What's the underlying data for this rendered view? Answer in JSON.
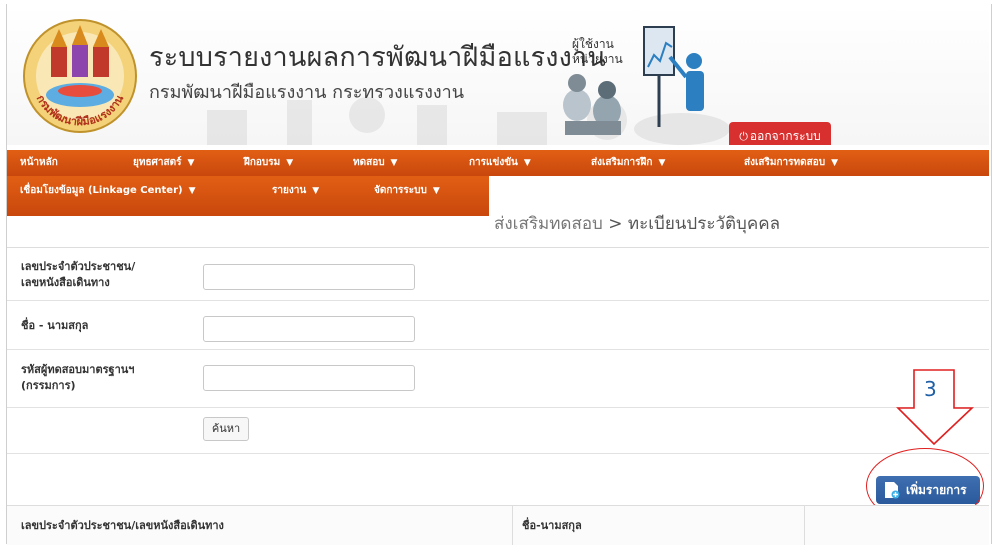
{
  "header": {
    "title": "ระบบรายงานผลการพัฒนาฝีมือแรงงาน",
    "subtitle": "กรมพัฒนาฝีมือแรงงาน กระทรวงแรงงาน",
    "role_line1": "ผู้ใช้งาน",
    "role_line2": "หน่วยงาน",
    "logo_text": "กรมพัฒนาฝีมือแรงงาน",
    "logout_label": "ออกจากระบบ",
    "logout_icon": "power-icon",
    "colors": {
      "accent": "#d8531a",
      "logout": "#d82f2f"
    }
  },
  "nav": {
    "row1": [
      {
        "label": "หน้าหลัก",
        "caret": ""
      },
      {
        "label": "ยุทธศาสตร์",
        "caret": "▼"
      },
      {
        "label": "ฝึกอบรม",
        "caret": "▼"
      },
      {
        "label": "ทดสอบ",
        "caret": "▼"
      },
      {
        "label": "การแข่งขัน",
        "caret": "▼"
      },
      {
        "label": "ส่งเสริมการฝึก",
        "caret": "▼"
      },
      {
        "label": "ส่งเสริมการทดสอบ",
        "caret": "▼"
      }
    ],
    "row2": [
      {
        "label": "เชื่อมโยงข้อมูล (Linkage Center)",
        "caret": "▼"
      },
      {
        "label": "รายงาน",
        "caret": "▼"
      },
      {
        "label": "จัดการระบบ",
        "caret": "▼"
      }
    ]
  },
  "breadcrumb": {
    "parent": "ส่งเสริมทดสอบ",
    "separator": ">",
    "current": "ทะเบียนประวัติบุคคล"
  },
  "search": {
    "id_label_1": "เลขประจำตัวประชาชน/",
    "id_label_2": "เลขหนังสือเดินทาง",
    "id_value": "",
    "name_label": "ชื่อ - นามสกุล",
    "name_value": "",
    "code_label_1": "รหัสผู้ทดสอบมาตรฐานฯ",
    "code_label_2": "(กรรมการ)",
    "code_value": "",
    "button_label": "ค้นหา"
  },
  "annotation": {
    "number": "3"
  },
  "add_button": {
    "label": "เพิ่มรายการ",
    "icon": "add-document-icon"
  },
  "table": {
    "headers": [
      "เลขประจำตัวประชาชน/เลขหนังสือเดินทาง",
      "ชื่อ-นามสกุล",
      ""
    ]
  }
}
